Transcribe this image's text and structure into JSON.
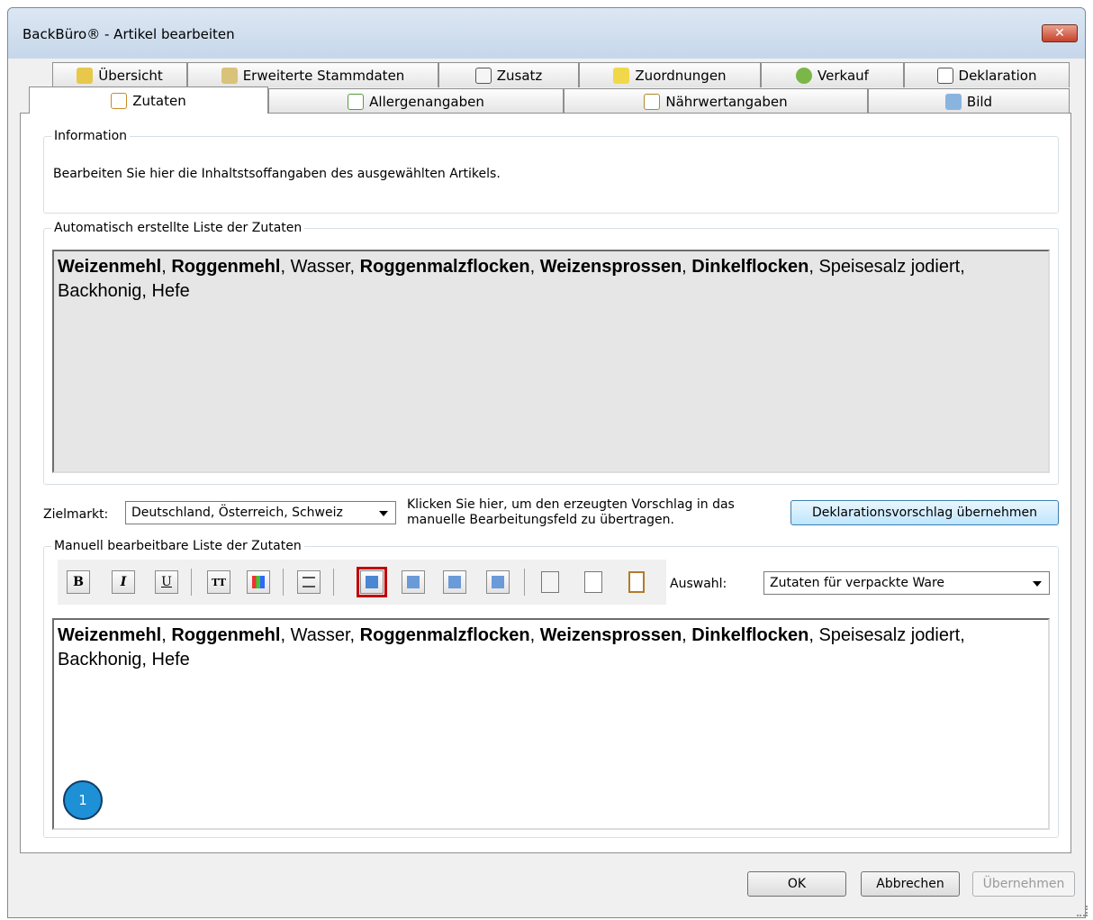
{
  "window": {
    "title": "BackBüro® - Artikel bearbeiten",
    "close": "✕"
  },
  "tabs_row1": [
    {
      "label": "Übersicht",
      "icon": "overview-icon"
    },
    {
      "label": "Erweiterte Stammdaten",
      "icon": "master-data-icon"
    },
    {
      "label": "Zusatz",
      "icon": "extra-icon"
    },
    {
      "label": "Zuordnungen",
      "icon": "assignment-icon"
    },
    {
      "label": "Verkauf",
      "icon": "sale-icon"
    },
    {
      "label": "Deklaration",
      "icon": "declaration-icon"
    }
  ],
  "tabs_row2": [
    {
      "label": "Zutaten",
      "icon": "ingredients-icon",
      "active": true
    },
    {
      "label": "Allergenangaben",
      "icon": "allergen-icon"
    },
    {
      "label": "Nährwertangaben",
      "icon": "nutrition-icon"
    },
    {
      "label": "Bild",
      "icon": "image-icon"
    }
  ],
  "information": {
    "legend": "Information",
    "text": "Bearbeiten Sie hier die Inhaltstsoffangaben des ausgewählten Artikels."
  },
  "auto_list": {
    "legend": "Automatisch erstellte Liste der Zutaten",
    "ingredients": [
      {
        "text": "Weizenmehl",
        "bold": true,
        "sep": ", "
      },
      {
        "text": "Roggenmehl",
        "bold": true,
        "sep": ", "
      },
      {
        "text": "Wasser",
        "bold": false,
        "sep": ", "
      },
      {
        "text": "Roggenmalzflocken",
        "bold": true,
        "sep": ", "
      },
      {
        "text": "Weizensprossen",
        "bold": true,
        "sep": ", "
      },
      {
        "text": "Dinkelflocken",
        "bold": true,
        "sep": ", "
      },
      {
        "text": "Speisesalz jodiert",
        "bold": false,
        "sep": ", "
      },
      {
        "text": "Backhonig",
        "bold": false,
        "sep": ", "
      },
      {
        "text": "Hefe",
        "bold": false,
        "sep": ""
      }
    ]
  },
  "zielmarkt": {
    "label": "Zielmarkt:",
    "value": "Deutschland, Österreich, Schweiz",
    "hint": "Klicken Sie hier, um den erzeugten Vorschlag in das manuelle Bearbeitungsfeld zu übertragen.",
    "button": "Deklarationsvorschlag übernehmen"
  },
  "manual_list": {
    "legend": "Manuell bearbeitbare Liste der Zutaten",
    "toolbar": {
      "bold": "B",
      "italic": "I",
      "underline": "U",
      "font": "TT"
    },
    "auswahl_label": "Auswahl:",
    "auswahl_value": "Zutaten für verpackte Ware",
    "ingredients": [
      {
        "text": "Weizenmehl",
        "bold": true,
        "sep": ", "
      },
      {
        "text": "Roggenmehl",
        "bold": true,
        "sep": ", "
      },
      {
        "text": "Wasser",
        "bold": false,
        "sep": ", "
      },
      {
        "text": "Roggenmalzflocken",
        "bold": true,
        "sep": ", "
      },
      {
        "text": "Weizensprossen",
        "bold": true,
        "sep": ", "
      },
      {
        "text": "Dinkelflocken",
        "bold": true,
        "sep": ", "
      },
      {
        "text": "Speisesalz jodiert",
        "bold": false,
        "sep": ", "
      },
      {
        "text": "Backhonig",
        "bold": false,
        "sep": ", "
      },
      {
        "text": "Hefe",
        "bold": false,
        "sep": ""
      }
    ]
  },
  "annotation": {
    "number": "1"
  },
  "buttons": {
    "ok": "OK",
    "cancel": "Abbrechen",
    "apply": "Übernehmen"
  },
  "colors": {
    "accent": "#1e90d6",
    "selected_outline": "#c00000"
  }
}
